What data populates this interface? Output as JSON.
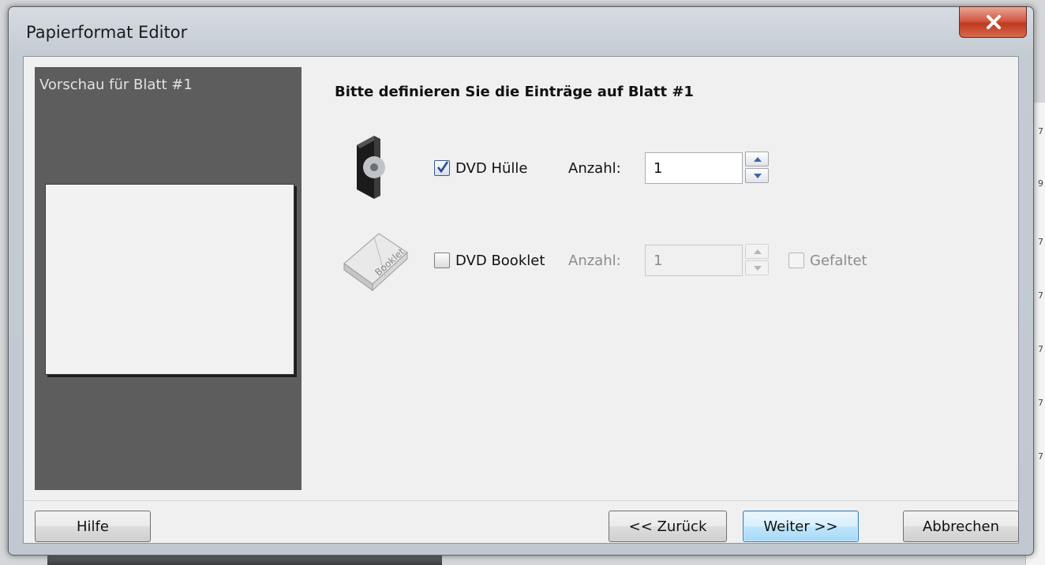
{
  "window": {
    "title": "Papierformat Editor"
  },
  "preview": {
    "label": "Vorschau für Blatt #1"
  },
  "heading": "Bitte definieren Sie die Einträge auf Blatt #1",
  "entries": [
    {
      "icon": "dvd-case-icon",
      "label": "DVD Hülle",
      "checked": true,
      "anzahl_label": "Anzahl:",
      "anzahl_value": "1",
      "enabled": true
    },
    {
      "icon": "booklet-icon",
      "label": "DVD Booklet",
      "checked": false,
      "anzahl_label": "Anzahl:",
      "anzahl_value": "1",
      "enabled": false,
      "fold_label": "Gefaltet",
      "fold_checked": false
    }
  ],
  "booklet_icon_text": "Booklet",
  "buttons": {
    "help": "Hilfe",
    "back": "<< Zurück",
    "next": "Weiter >>",
    "cancel": "Abbrechen"
  },
  "colors": {
    "preview_bg": "#5d5d5d",
    "close_button": "#c0391f",
    "primary_button_border": "#3c7fb1",
    "disabled_text": "#8c8c8c"
  }
}
